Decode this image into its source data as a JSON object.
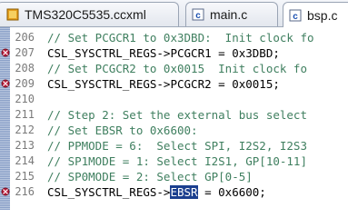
{
  "tabs": [
    {
      "label": "TMS320C5535.ccxml",
      "icon": "ccxml-file-icon",
      "active": false
    },
    {
      "label": "main.c",
      "icon": "c-file-icon",
      "active": false
    },
    {
      "label": "bsp.c",
      "icon": "c-file-icon",
      "active": true
    }
  ],
  "editor": {
    "lines": [
      {
        "num": "206",
        "text": "// Set PCGCR1 to 0x3DBD:  Init clock fo",
        "type": "comment"
      },
      {
        "num": "207",
        "text": "CSL_SYSCTRL_REGS->PCGCR1 = 0x3DBD;",
        "type": "code",
        "breakpoint": true
      },
      {
        "num": "208",
        "text": "// Set PCGCR2 to 0x0015  Init clock fo",
        "type": "comment"
      },
      {
        "num": "209",
        "text": "CSL_SYSCTRL_REGS->PCGCR2 = 0x0015;",
        "type": "code",
        "breakpoint": true
      },
      {
        "num": "210",
        "text": "",
        "type": "code"
      },
      {
        "num": "211",
        "text": "// Step 2: Set the external bus select",
        "type": "comment"
      },
      {
        "num": "212",
        "text": "// Set EBSR to 0x6600:",
        "type": "comment"
      },
      {
        "num": "213",
        "text": "// PPMODE = 6:  Select SPI, I2S2, I2S3",
        "type": "comment"
      },
      {
        "num": "214",
        "text": "// SP1MODE = 1: Select I2S1, GP[10-11]",
        "type": "comment"
      },
      {
        "num": "215",
        "text": "// SP0MODE = 2: Select GP[0-5]",
        "type": "comment"
      },
      {
        "num": "216",
        "prefix": "CSL_SYSCTRL_REGS->",
        "highlight": "EBSR",
        "suffix": " = 0x6600;",
        "type": "code",
        "breakpoint": true
      }
    ]
  },
  "colors": {
    "comment": "#3f7f5f",
    "code": "#000000",
    "selection": "#1b3f8f",
    "line_number": "#7a7a7a"
  }
}
